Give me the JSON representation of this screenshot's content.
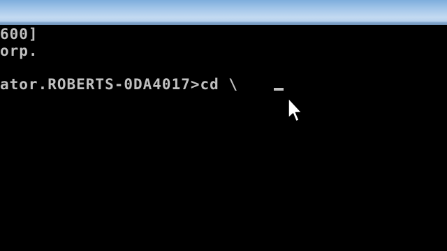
{
  "console": {
    "lines": [
      "600]",
      "orp.",
      "ator.ROBERTS-0DA4017>cd \\"
    ]
  },
  "icons": {
    "pointer": "mouse-pointer-icon",
    "caret": "text-caret"
  },
  "colors": {
    "console_bg": "#000000",
    "console_text": "#c0c0c0",
    "title_bar": "#a7c8ea"
  }
}
